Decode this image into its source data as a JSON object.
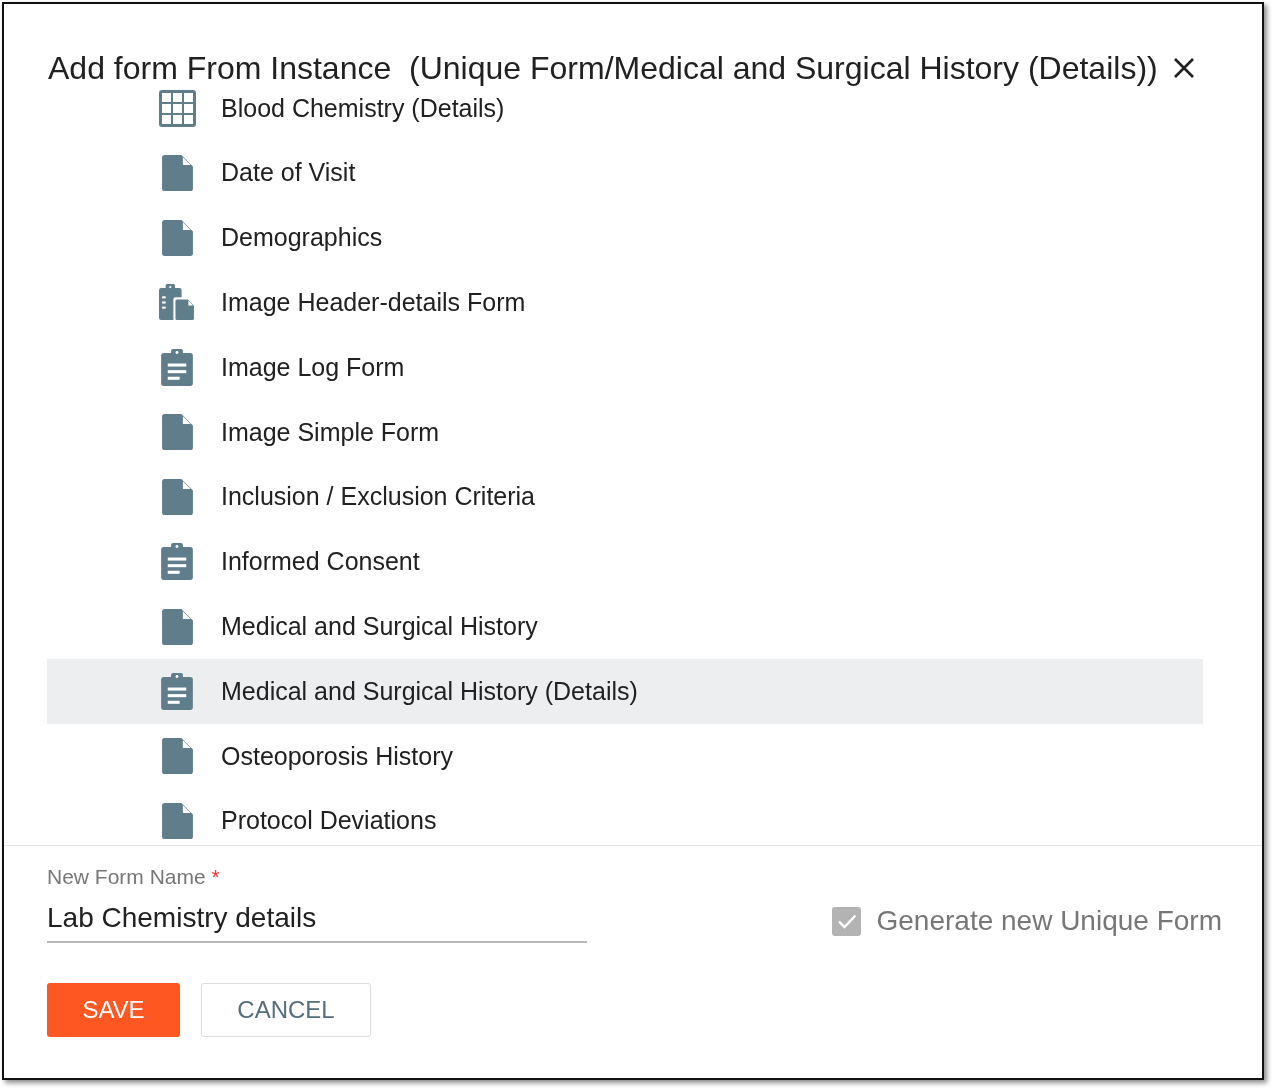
{
  "dialog": {
    "title": "Add form From Instance  (Unique Form/Medical and Surgical History (Details))"
  },
  "forms": [
    {
      "label": "Blood Chemistry (Details)",
      "kind": "table",
      "selected": false
    },
    {
      "label": "Date of Visit",
      "kind": "file",
      "selected": false
    },
    {
      "label": "Demographics",
      "kind": "file",
      "selected": false
    },
    {
      "label": "Image Header-details Form",
      "kind": "clipboard-file",
      "selected": false
    },
    {
      "label": "Image Log Form",
      "kind": "clipboard",
      "selected": false
    },
    {
      "label": "Image Simple Form",
      "kind": "file",
      "selected": false
    },
    {
      "label": "Inclusion / Exclusion Criteria",
      "kind": "file",
      "selected": false
    },
    {
      "label": "Informed Consent",
      "kind": "clipboard",
      "selected": false
    },
    {
      "label": "Medical and Surgical History",
      "kind": "file",
      "selected": false
    },
    {
      "label": "Medical and Surgical History (Details)",
      "kind": "clipboard",
      "selected": true
    },
    {
      "label": "Osteoporosis History",
      "kind": "file",
      "selected": false
    },
    {
      "label": "Protocol Deviations",
      "kind": "file",
      "selected": false
    }
  ],
  "new_form_name": {
    "label": "New Form Name",
    "required_mark": "*",
    "value": "Lab Chemistry details"
  },
  "generate_unique": {
    "label": "Generate new Unique Form",
    "checked": true,
    "disabled": true
  },
  "buttons": [
    {
      "label": "SAVE",
      "kind": "primary"
    },
    {
      "label": "CANCEL",
      "kind": "secondary"
    }
  ]
}
